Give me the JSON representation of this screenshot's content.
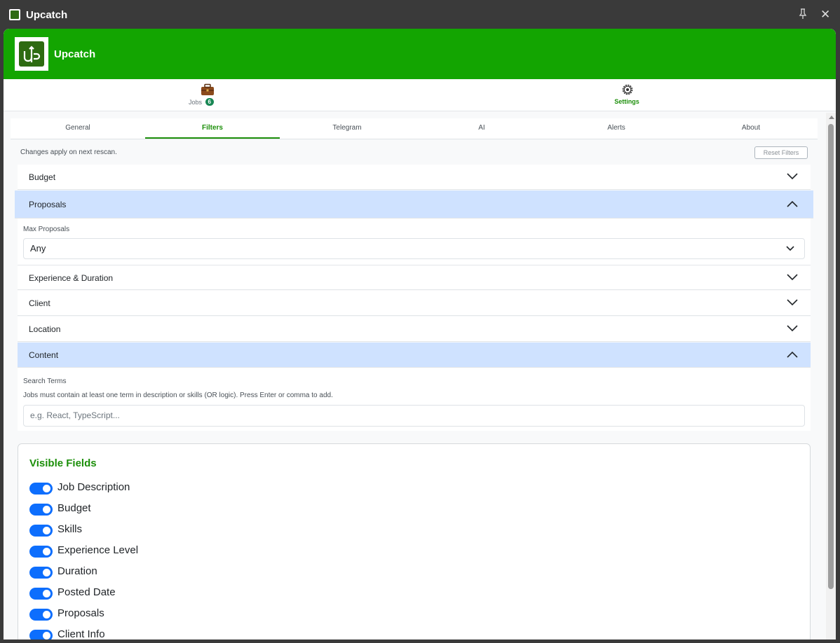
{
  "window": {
    "title": "Upcatch"
  },
  "header": {
    "brand": "Upcatch"
  },
  "main_nav": {
    "jobs": {
      "label": "Jobs",
      "badge": "6"
    },
    "settings": {
      "label": "Settings"
    }
  },
  "sub_tabs": [
    "General",
    "Filters",
    "Telegram",
    "AI",
    "Alerts",
    "About"
  ],
  "active_sub_tab": "Filters",
  "filters": {
    "note": "Changes apply on next rescan.",
    "reset_label": "Reset Filters",
    "sections": {
      "budget": "Budget",
      "proposals": "Proposals",
      "experience": "Experience & Duration",
      "client": "Client",
      "location": "Location",
      "content": "Content"
    },
    "max_proposals": {
      "label": "Max Proposals",
      "value": "Any"
    },
    "search_terms": {
      "label": "Search Terms",
      "help": "Jobs must contain at least one term in description or skills (OR logic). Press Enter or comma to add.",
      "placeholder": "e.g. React, TypeScript..."
    }
  },
  "visible_fields": {
    "title": "Visible Fields",
    "items": [
      {
        "label": "Job Description",
        "on": true
      },
      {
        "label": "Budget",
        "on": true
      },
      {
        "label": "Skills",
        "on": true
      },
      {
        "label": "Experience Level",
        "on": true
      },
      {
        "label": "Duration",
        "on": true
      },
      {
        "label": "Posted Date",
        "on": true
      },
      {
        "label": "Proposals",
        "on": true
      },
      {
        "label": "Client Info",
        "on": true
      }
    ]
  },
  "colors": {
    "brand_green": "#13a501",
    "accent_blue": "#0d6efd",
    "open_section": "#cfe2ff"
  }
}
